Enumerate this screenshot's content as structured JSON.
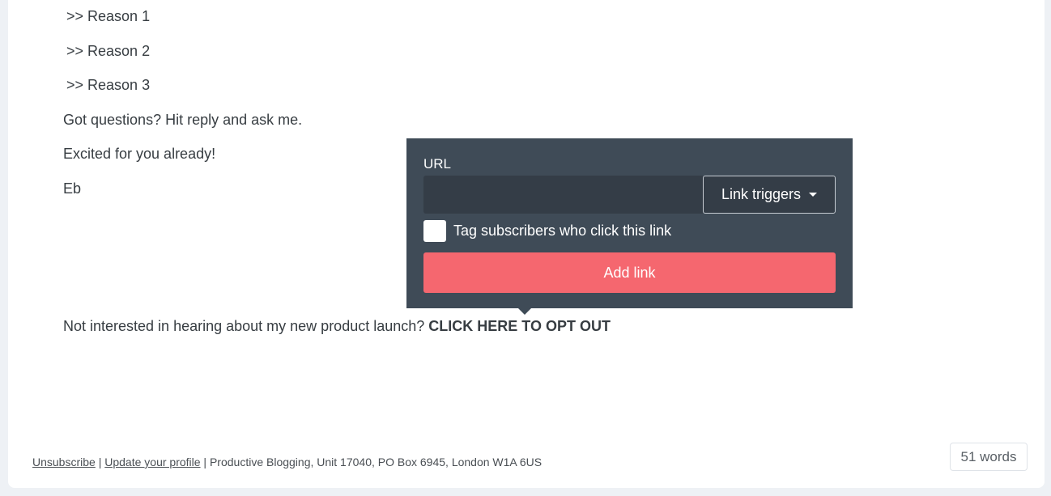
{
  "email_body": {
    "reasons": [
      ">> Reason 1",
      ">> Reason 2",
      ">> Reason 3"
    ],
    "questions": "Got questions? Hit reply and ask me.",
    "excited": "Excited for you already!",
    "signature": "Eb",
    "opt_out_text": "Not interested in hearing about my new product launch?",
    "opt_out_link": "CLICK HERE TO OPT OUT"
  },
  "footer": {
    "unsubscribe": "Unsubscribe",
    "separator1": " | ",
    "update_profile": "Update your profile",
    "separator2": " | ",
    "address": "Productive Blogging, Unit 17040, PO Box 6945, London W1A 6US"
  },
  "word_count": "51 words",
  "link_popover": {
    "url_label": "URL",
    "url_value": "",
    "link_triggers_label": "Link triggers",
    "tag_checkbox_label": "Tag subscribers who click this link",
    "tag_checked": false,
    "add_link_label": "Add link",
    "colors": {
      "background": "#3f4b57",
      "button": "#f5676f"
    }
  }
}
